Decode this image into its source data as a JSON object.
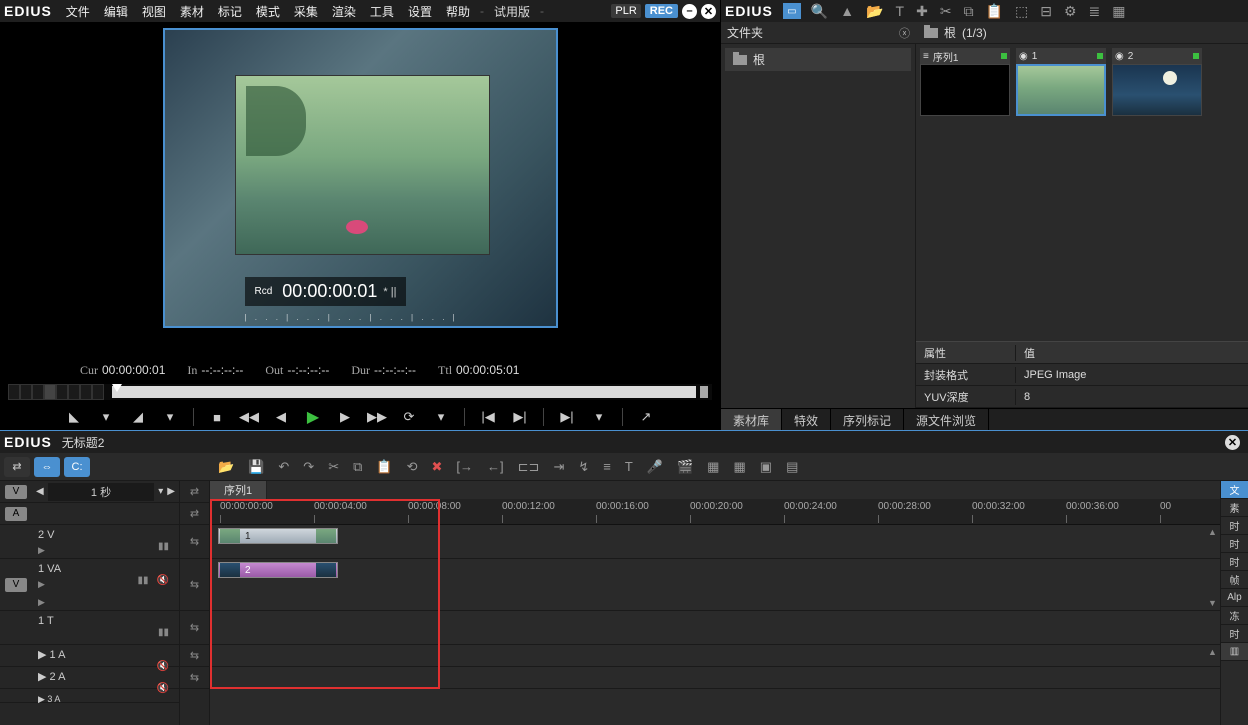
{
  "brand": "EDIUS",
  "menu": {
    "items": [
      "文件",
      "编辑",
      "视图",
      "素材",
      "标记",
      "模式",
      "采集",
      "渲染",
      "工具",
      "设置",
      "帮助"
    ],
    "trial": "试用版",
    "plr": "PLR",
    "rec": "REC"
  },
  "preview": {
    "rcd_label": "Rcd",
    "rcd_tc": "00:00:00:01",
    "rcd_suffix": "*   ||",
    "tc": {
      "cur_lbl": "Cur",
      "cur": "00:00:00:01",
      "in_lbl": "In",
      "in": "--:--:--:--",
      "out_lbl": "Out",
      "out": "--:--:--:--",
      "dur_lbl": "Dur",
      "dur": "--:--:--:--",
      "ttl_lbl": "Ttl",
      "ttl": "00:00:05:01"
    }
  },
  "bin": {
    "panel_label": "文件夹",
    "crumb_root": "根",
    "crumb_count": "(1/3)",
    "tree": {
      "root": "根"
    },
    "thumbs": [
      {
        "icon": "≡",
        "label": "序列1",
        "kind": "black"
      },
      {
        "icon": "◉",
        "label": "1",
        "kind": "scene"
      },
      {
        "icon": "◉",
        "label": "2",
        "kind": "moon"
      }
    ],
    "props": {
      "h1": "属性",
      "h2": "值",
      "r1k": "封装格式",
      "r1v": "JPEG Image",
      "r2k": "YUV深度",
      "r2v": "8"
    },
    "tabs": [
      "素材库",
      "特效",
      "序列标记",
      "源文件浏览"
    ]
  },
  "timeline": {
    "title": "无标题2",
    "seq_tab": "序列1",
    "zoom": "1 秒",
    "va_labels": {
      "v": "V",
      "a": "A"
    },
    "tracks": {
      "t2v": "2 V",
      "t1va": "1 VA",
      "t1t": "1 T",
      "t1a": "1 A",
      "t2a": "2 A",
      "t3a": "3 A"
    },
    "ruler": [
      "00:00:00:00",
      "00:00:04:00",
      "00:00:08:00",
      "00:00:12:00",
      "00:00:16:00",
      "00:00:20:00",
      "00:00:24:00",
      "00:00:28:00",
      "00:00:32:00",
      "00:00:36:00",
      "00"
    ],
    "clips": {
      "c1": "1",
      "c2": "2"
    },
    "right_strip": [
      "文",
      "素",
      "时",
      "时",
      "时",
      "帧",
      "Alp",
      "冻",
      "时"
    ]
  }
}
